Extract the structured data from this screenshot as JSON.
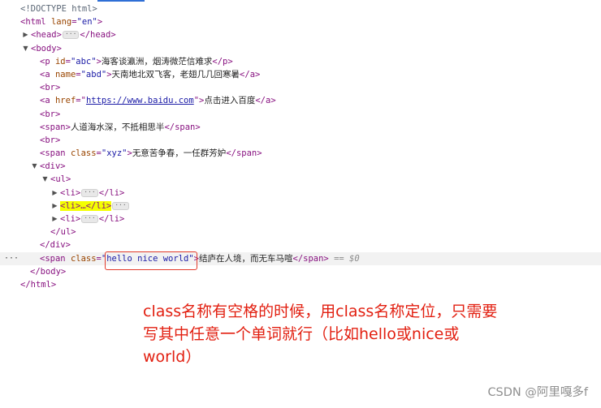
{
  "tree": {
    "doctype": "<!DOCTYPE html>",
    "html_open": "<html",
    "html_lang_attr": "lang",
    "html_lang_val": "\"en\"",
    "gt": ">",
    "head_open": "<head>",
    "head_close": "</head>",
    "body_open": "<body>",
    "p_open": "<p",
    "p_attr": "id",
    "p_val": "\"abc\"",
    "p_text": "海客谈瀛洲，烟涛微茫信难求",
    "p_close": "</p>",
    "a1_open": "<a",
    "a1_attr": "name",
    "a1_val": "\"abd\"",
    "a1_text": "天南地北双飞客，老翅几几回寒暑",
    "a_close": "</a>",
    "br": "<br>",
    "a2_open": "<a",
    "a2_attr": "href",
    "a2_val_url": "https://www.baidu.com",
    "a2_text": "点击进入百度",
    "span1_open": "<span>",
    "span1_text": "人道海水深，不抵相思半",
    "span_close": "</span>",
    "span2_open": "<span",
    "span2_attr": "class",
    "span2_val": "\"xyz\"",
    "span2_text": "无意苦争春，一任群芳妒",
    "div_open": "<div>",
    "ul_open": "<ul>",
    "li_open": "<li>",
    "li_close": "</li>",
    "li2_ellipsis": "…",
    "ul_close": "</ul>",
    "div_close": "</div>",
    "span3_open": "<span",
    "span3_attr": "class",
    "span3_val": "\"hello nice world\"",
    "span3_text": "结庐在人境，而无车马喧",
    "eq0": "== $0",
    "body_close": "</body>",
    "html_close": "</html>",
    "badge": "···",
    "dots": "···",
    "tri_right": "▶",
    "tri_down": "▼"
  },
  "note": {
    "line1": "class名称有空格的时候，用class名称定位，只需要",
    "line2": "写其中任意一个单词就行（比如hello或nice或",
    "line3": "world）"
  },
  "watermark": "CSDN @阿里嘎多f",
  "colors": {
    "tag": "#881280",
    "attr": "#994500",
    "value": "#1a1aa6",
    "highlight": "#f4ff00",
    "annotation": "#e21f10",
    "selected_row": "#f2f2f2"
  }
}
